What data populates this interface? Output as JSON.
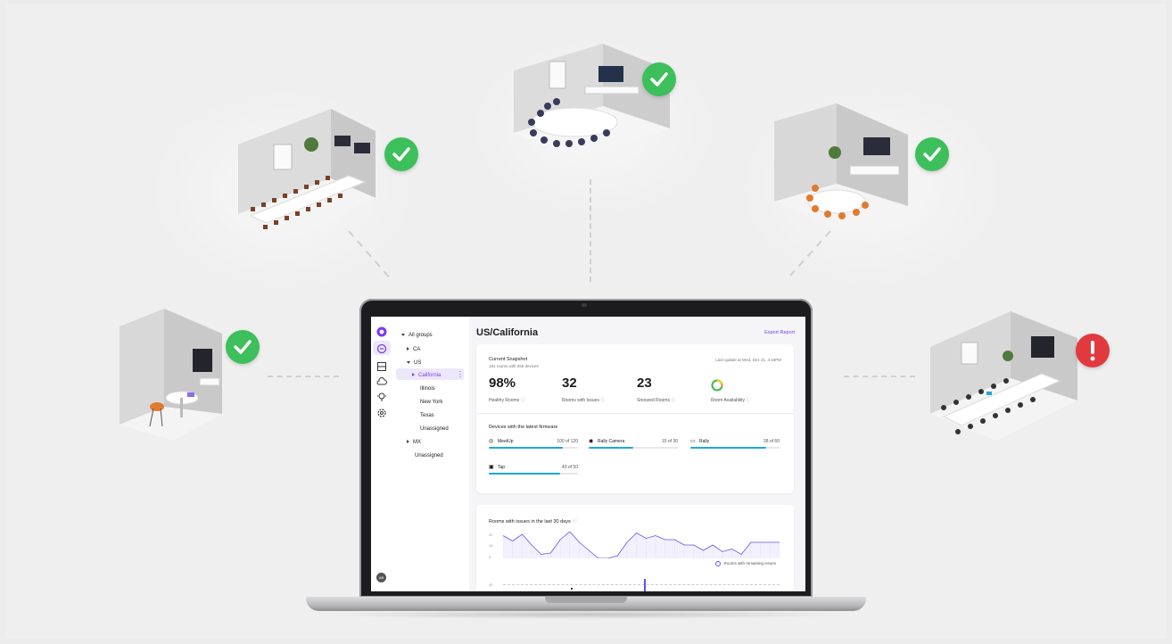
{
  "app": {
    "page_title": "US/California",
    "export_label": "Export Report",
    "user_initials": "AB"
  },
  "tree": {
    "items": [
      {
        "label": "All groups",
        "level": 0,
        "toggle": "down"
      },
      {
        "label": "CA",
        "level": 1,
        "toggle": "right"
      },
      {
        "label": "US",
        "level": 1,
        "toggle": "down"
      },
      {
        "label": "California",
        "level": 2,
        "toggle": "right",
        "selected": true
      },
      {
        "label": "Illinois",
        "level": 3,
        "toggle": ""
      },
      {
        "label": "New York",
        "level": 3,
        "toggle": ""
      },
      {
        "label": "Texas",
        "level": 3,
        "toggle": ""
      },
      {
        "label": "Unassigned",
        "level": 3,
        "toggle": ""
      },
      {
        "label": "MX",
        "level": 1,
        "toggle": "right"
      },
      {
        "label": "Unassigned",
        "level": 2,
        "toggle": ""
      }
    ]
  },
  "snapshot": {
    "title": "Current Snapshot",
    "subtitle": "181 rooms with 255 devices",
    "last_update": "Last update at  Wed, Dec 21, 4:18PM",
    "stats": [
      {
        "value": "98%",
        "label": "Healthy Rooms"
      },
      {
        "value": "32",
        "label": "Rooms with Issues"
      },
      {
        "value": "23",
        "label": "Snoozed Rooms"
      },
      {
        "value": "",
        "label": "Room Availability"
      }
    ],
    "availability_colors": [
      "#3fb950",
      "#f5c518",
      "#f08a24"
    ]
  },
  "firmware": {
    "title": "Devices with the latest firmware",
    "devices": [
      {
        "name": "MeetUp",
        "count": "100 of 120",
        "fraction": 0.83,
        "icon": "meetup-icon"
      },
      {
        "name": "Rally Camera",
        "count": "15 of 30",
        "fraction": 0.5,
        "icon": "camera-icon"
      },
      {
        "name": "Rally",
        "count": "38 of 60",
        "fraction": 0.85,
        "icon": "rally-icon"
      },
      {
        "name": "Tap",
        "count": "40 of 50",
        "fraction": 0.8,
        "icon": "tap-icon"
      }
    ]
  },
  "issues_chart": {
    "title": "Rooms with issues in the last 30 days",
    "legend": "Rooms with remaining issues",
    "yticks": [
      "20",
      "15",
      "0"
    ],
    "lower_tick": "40"
  },
  "chart_data": {
    "type": "area",
    "title": "Rooms with issues in the last 30 days",
    "series": [
      {
        "name": "Rooms with remaining issues",
        "values": [
          17,
          13,
          18,
          10,
          3,
          4,
          14,
          20,
          12,
          6,
          0,
          0,
          2,
          12,
          19,
          15,
          17,
          14,
          14,
          10,
          10,
          6,
          10,
          5,
          7,
          3,
          12,
          12,
          12,
          12
        ]
      }
    ],
    "ylim": [
      0,
      20
    ],
    "color": "#6a4cf0"
  },
  "rooms": [
    {
      "name": "boardroom",
      "status": "ok"
    },
    {
      "name": "conference-room",
      "status": "ok"
    },
    {
      "name": "meeting-room",
      "status": "ok"
    },
    {
      "name": "huddle-room",
      "status": "ok"
    },
    {
      "name": "training-room",
      "status": "error"
    }
  ],
  "colors": {
    "ok": "#3dbf5b",
    "error": "#e03a3e",
    "accent": "#7a3cf0",
    "bar": "#1ea7e0"
  }
}
